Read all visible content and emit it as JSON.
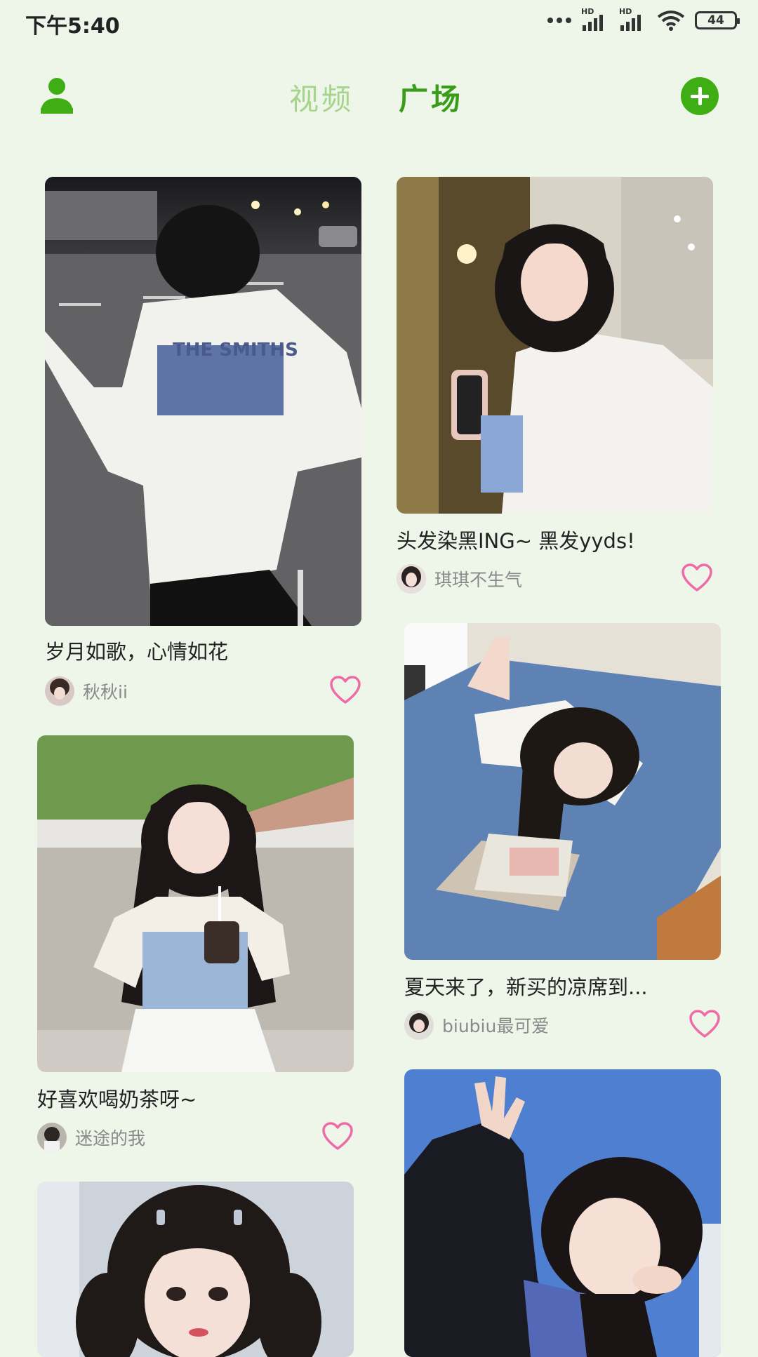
{
  "status": {
    "time": "下午5:40",
    "hd1": "HD",
    "hd2": "HD",
    "battery": "44"
  },
  "header": {
    "tab_video": "视频",
    "tab_square": "广场"
  },
  "posts": [
    {
      "title": "岁月如歌，心情如花",
      "user": "秋秋ii",
      "photo": "photo of a young man in a white THE SMITHS t-shirt on a street at night",
      "shirt_text": "THE SMITHS"
    },
    {
      "title": "头发染黑ING~ 黑发yyds!",
      "user": "琪琪不生气",
      "photo": "photo of a smiling girl with black hair holding a phone in a salon"
    },
    {
      "title": "好喜欢喝奶茶呀~",
      "user": "迷途的我",
      "photo": "photo of a girl with long black hair holding a milk tea on a chair"
    },
    {
      "title": "夏天来了，新买的凉席到...",
      "user": "biubiu最可爱",
      "photo": "photo of a girl lying on a blue bed mat with a laptop"
    },
    {
      "title": "",
      "user": "",
      "photo": "photo of a girl with pigtails"
    },
    {
      "title": "",
      "user": "",
      "photo": "photo of a girl waving under a blue sky"
    }
  ],
  "icons": {
    "user": "user-icon",
    "add": "add-icon",
    "like": "heart-outline-icon"
  },
  "colors": {
    "background": "#eef6ea",
    "accent": "#3eae14",
    "tab_inactive": "#a6d48a",
    "heart": "#f06aa6"
  }
}
